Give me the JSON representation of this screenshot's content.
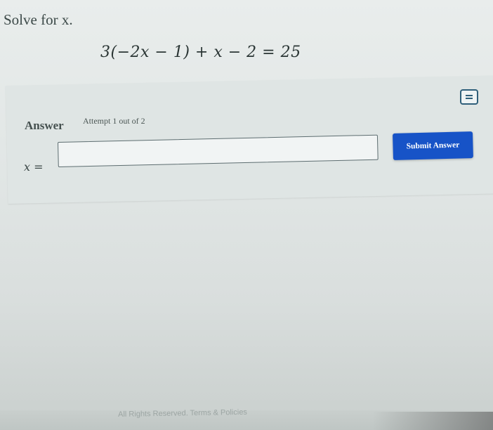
{
  "question": {
    "title": "Solve for x.",
    "equation": "3(−2x − 1) + x − 2 = 25"
  },
  "answer_section": {
    "label": "Answer",
    "attempt_text": "Attempt 1 out of 2",
    "variable_label": "x =",
    "input_value": "",
    "submit_label": "Submit Answer"
  },
  "icons": {
    "calculator": "calculator-icon"
  },
  "colors": {
    "submit_button": "#1753c7",
    "background": "#e3e8e7"
  },
  "footer": {
    "text": "All Rights Reserved. Terms & Policies"
  }
}
